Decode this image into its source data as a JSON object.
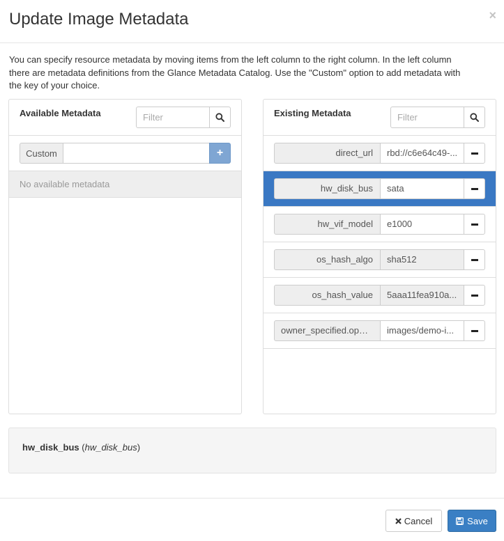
{
  "dialog": {
    "title": "Update Image Metadata",
    "close_glyph": "×",
    "description": "You can specify resource metadata by moving items from the left column to the right column. In the left column there are metadata definitions from the Glance Metadata Catalog. Use the \"Custom\" option to add metadata with the key of your choice."
  },
  "available": {
    "title": "Available Metadata",
    "filter_placeholder": "Filter",
    "custom_label": "Custom",
    "custom_value": "",
    "add_glyph": "+",
    "empty_text": "No available metadata"
  },
  "existing": {
    "title": "Existing Metadata",
    "filter_placeholder": "Filter",
    "items": [
      {
        "key": "direct_url",
        "value": "rbd://c6e64c49-...",
        "readonly": false,
        "active": false
      },
      {
        "key": "hw_disk_bus",
        "value": "sata",
        "readonly": false,
        "active": true
      },
      {
        "key": "hw_vif_model",
        "value": "e1000",
        "readonly": false,
        "active": false
      },
      {
        "key": "os_hash_algo",
        "value": "sha512",
        "readonly": true,
        "active": false
      },
      {
        "key": "os_hash_value",
        "value": "5aaa11fea910a...",
        "readonly": true,
        "active": false
      },
      {
        "key": "owner_specified.open...",
        "value": "images/demo-i...",
        "readonly": false,
        "active": false
      }
    ]
  },
  "detail": {
    "key": "hw_disk_bus",
    "open_paren": " (",
    "name": "hw_disk_bus",
    "close_paren": ")"
  },
  "footer": {
    "cancel_label": "Cancel",
    "save_label": "Save"
  },
  "colors": {
    "accent": "#3a78c3",
    "add_button": "#7fa6d3"
  }
}
